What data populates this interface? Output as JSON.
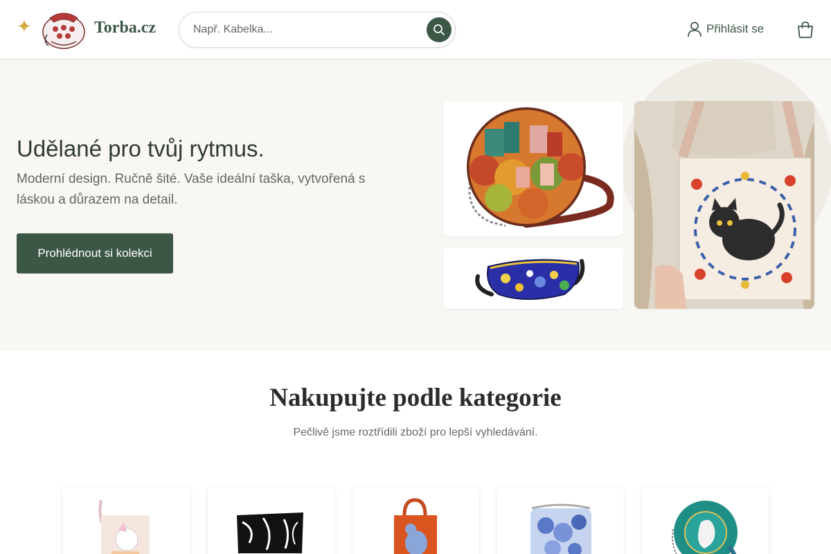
{
  "header": {
    "brand": "Torba.cz",
    "search_placeholder": "Např. Kabelka...",
    "login_label": "Přihlásit se"
  },
  "hero": {
    "title": "Udělané pro tvůj rytmus.",
    "subtitle": "Moderní design. Ručně šité. Vaše ideální taška, vytvořená s láskou a důrazem na detail.",
    "cta_label": "Prohlédnout si kolekci"
  },
  "categories": {
    "title": "Nakupujte podle kategorie",
    "subtitle": "Pečlivě jsme roztřídili zboží pro lepší vyhledávání."
  },
  "colors": {
    "brand_green": "#3d5747",
    "accent_gold": "#d2a93c",
    "hero_background": "#f9f7f3"
  },
  "icons": [
    "sparkle-icon",
    "search-icon",
    "user-icon",
    "cart-icon"
  ]
}
